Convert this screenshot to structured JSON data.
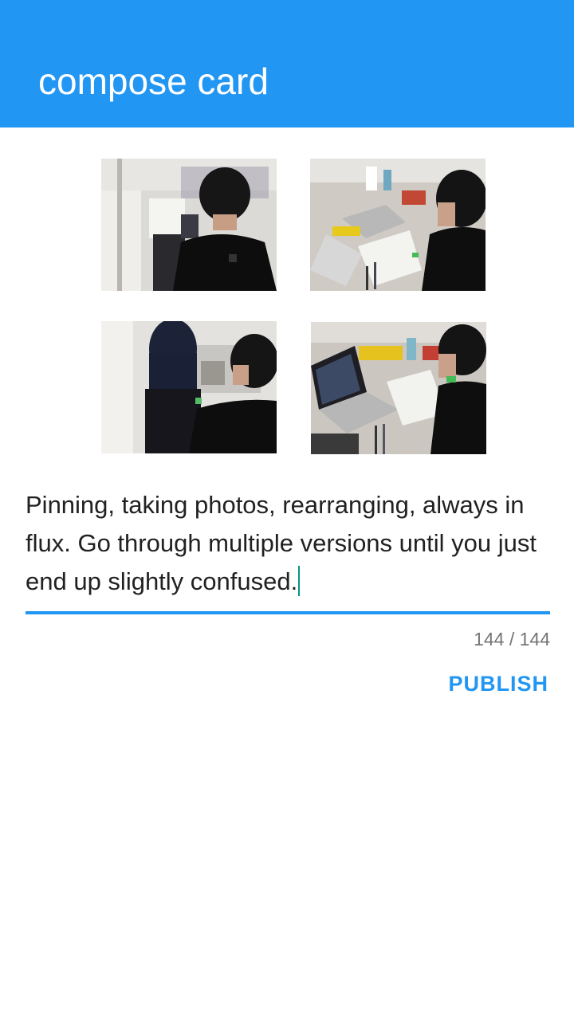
{
  "app_bar": {
    "title": "compose card",
    "color": "#2196F3"
  },
  "photos": [
    {
      "name": "photo-1"
    },
    {
      "name": "photo-2"
    },
    {
      "name": "photo-3"
    },
    {
      "name": "photo-4"
    }
  ],
  "caption": {
    "value": "Pinning, taking photos, rearranging, always in flux. Go through multiple versions until you just end up slightly confused."
  },
  "counter": {
    "text": "144 / 144"
  },
  "actions": {
    "publish_label": "PUBLISH"
  }
}
